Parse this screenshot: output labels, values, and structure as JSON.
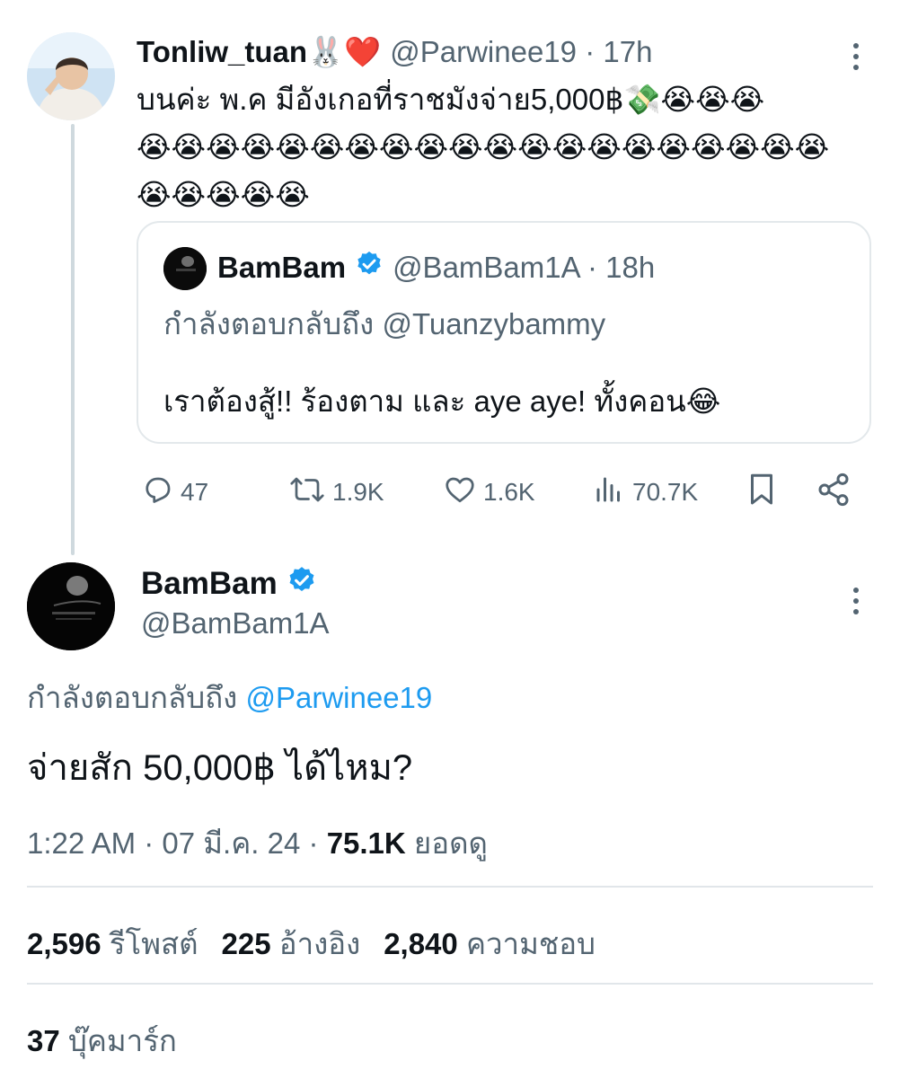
{
  "parent_tweet": {
    "display_name": "Tonliw_tuan",
    "name_emojis": "🐰❤️",
    "handle": "@Parwinee19",
    "time": "17h",
    "text_lines": [
      "บนค่ะ พ.ค มีอังเกอที่ราชมังจ่าย5,000฿💸😭😭😭",
      "😭😭😭😭😭😭😭😭😭😭😭😭😭😭😭😭😭😭😭😭",
      "😭😭😭😭😭"
    ],
    "quoted": {
      "display_name": "BamBam",
      "handle": "@BamBam1A",
      "time": "18h",
      "reply_prefix": "กำลังตอบกลับถึง",
      "reply_to": "@Tuanzybammy",
      "text": "เราต้องสู้!! ร้องตาม และ aye aye! ทั้งคอน😂"
    },
    "actions": {
      "replies": "47",
      "reposts": "1.9K",
      "likes": "1.6K",
      "views": "70.7K"
    }
  },
  "main_tweet": {
    "display_name": "BamBam",
    "handle": "@BamBam1A",
    "reply_prefix": "กำลังตอบกลับถึง",
    "reply_to": "@Parwinee19",
    "text": "จ่ายสัก 50,000฿ ได้ไหม?",
    "time": "1:22 AM",
    "date": "07 มี.ค. 24",
    "views": "75.1K",
    "views_label": "ยอดดู",
    "stats": {
      "reposts": "2,596",
      "reposts_label": "รีโพสต์",
      "quotes": "225",
      "quotes_label": "อ้างอิง",
      "likes": "2,840",
      "likes_label": "ความชอบ",
      "bookmarks": "37",
      "bookmarks_label": "บุ๊คมาร์ก"
    }
  },
  "colors": {
    "accent": "#1d9bf0",
    "secondary_text": "#536471",
    "divider": "#e1e6ea"
  }
}
